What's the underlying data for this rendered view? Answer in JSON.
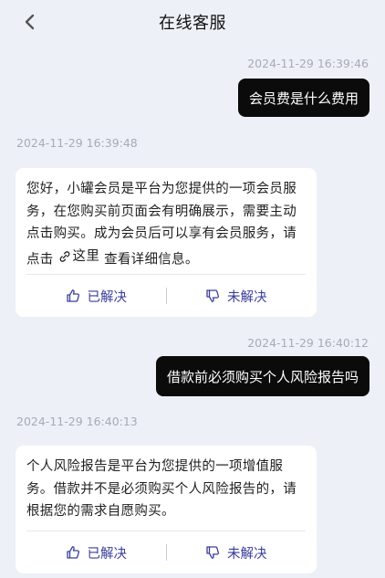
{
  "header": {
    "title": "在线客服",
    "back_icon": "chevron-left-icon"
  },
  "messages": [
    {
      "type": "user",
      "timestamp": "2024-11-29 16:39:46",
      "text": "会员费是什么费用"
    },
    {
      "type": "bot",
      "timestamp": "2024-11-29 16:39:48",
      "text_before_link": "您好，小罐会员是平台为您提供的一项会员服务，在您购买前页面会有明确展示，需要主动点击购买。成为会员后可以享有会员服务，请点击",
      "link_text": "这里",
      "text_after_link": "查看详细信息。",
      "helpful_label": "已解决",
      "unhelpful_label": "未解决"
    },
    {
      "type": "user",
      "timestamp": "2024-11-29 16:40:12",
      "text": "借款前必须购买个人风险报告吗"
    },
    {
      "type": "bot",
      "timestamp": "2024-11-29 16:40:13",
      "text": "个人风险报告是平台为您提供的一项增值服务。借款并不是必须购买个人风险报告的，请根据您的需求自愿购买。",
      "helpful_label": "已解决",
      "unhelpful_label": "未解决"
    }
  ],
  "colors": {
    "background": "#eef0f7",
    "user_bubble": "#0b0b0b",
    "accent": "#3a3d9a",
    "timestamp": "#a7abb8"
  }
}
